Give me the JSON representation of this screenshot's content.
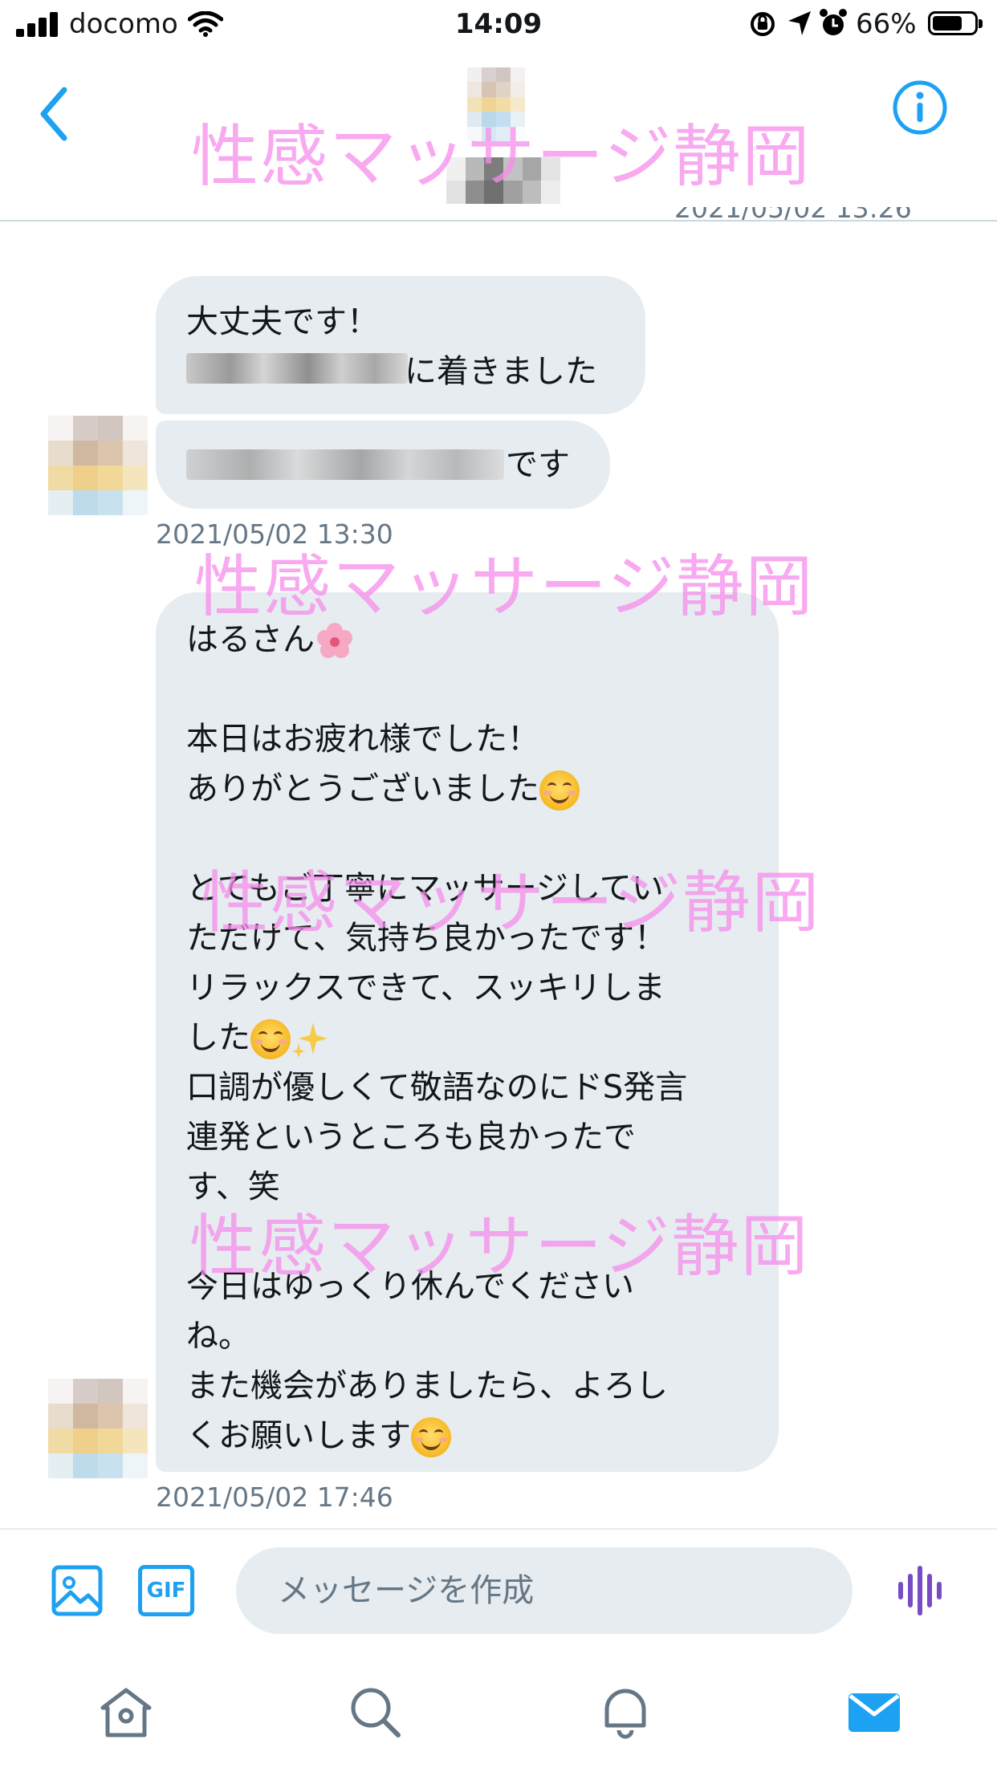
{
  "status_bar": {
    "carrier": "docomo",
    "time": "14:09",
    "battery": "66%"
  },
  "header": {
    "back_icon": "chevron-left-icon",
    "info_icon": "info-icon"
  },
  "conversation": {
    "cut_timestamp": "2021/05/02 13:26",
    "messages": [
      {
        "lines_visible": [
          "大丈夫です！",
          "に着きました"
        ]
      },
      {
        "suffix": "です"
      }
    ],
    "timestamp_1": "2021/05/02 13:30",
    "long_message": {
      "text": "はるさん🌸\n\n本日はお疲れ様でした！\nありがとうございました😊\n\nとてもご丁寧にマッサージしていただけて、気持ち良かったです！\nリラックスできて、スッキリしました☺️✨\n口調が優しくて敬語なのにドS発言連発というところも良かったです、笑\n\n今日はゆっくり休んでくださいね。\nまた機会がありましたら、よろしくお願いします😊",
      "lines": [
        "はるさん",
        "",
        "本日はお疲れ様でした！",
        "ありがとうございました",
        "",
        "とてもご丁寧にマッサージしてい",
        "ただけて、気持ち良かったです！",
        "リラックスできて、スッキリしま",
        "した",
        "口調が優しくて敬語なのにドS発言",
        "連発というところも良かったで",
        "す、笑",
        "",
        "今日はゆっくり休んでください",
        "ね。",
        "また機会がありましたら、よろし",
        "くお願いします"
      ]
    },
    "timestamp_2": "2021/05/02 17:46"
  },
  "watermark": "性感マッサージ静岡",
  "composer": {
    "placeholder": "メッセージを作成",
    "gif_label": "GIF"
  },
  "tabs": [
    "home-icon",
    "search-icon",
    "notifications-icon",
    "messages-icon"
  ],
  "colors": {
    "accent": "#1da1f2",
    "bubble": "#e6ecf0",
    "watermark": "#f68ceb",
    "voice": "#794bc4"
  }
}
